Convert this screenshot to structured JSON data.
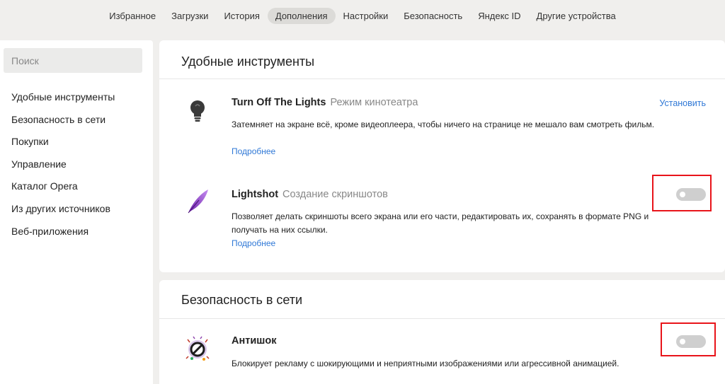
{
  "topnav": {
    "tabs": [
      {
        "label": "Избранное"
      },
      {
        "label": "Загрузки"
      },
      {
        "label": "История"
      },
      {
        "label": "Дополнения"
      },
      {
        "label": "Настройки"
      },
      {
        "label": "Безопасность"
      },
      {
        "label": "Яндекс ID"
      },
      {
        "label": "Другие устройства"
      }
    ],
    "active": "Дополнения"
  },
  "sidebar": {
    "search_placeholder": "Поиск",
    "items": [
      {
        "label": "Удобные инструменты"
      },
      {
        "label": "Безопасность в сети"
      },
      {
        "label": "Покупки"
      },
      {
        "label": "Управление"
      },
      {
        "label": "Каталог Opera"
      },
      {
        "label": "Из других источников"
      },
      {
        "label": "Веб-приложения"
      }
    ]
  },
  "sections": [
    {
      "title": "Удобные инструменты",
      "extensions": [
        {
          "name": "Turn Off The Lights",
          "subtitle": "Режим кинотеатра",
          "description": "Затемняет на экране всё, кроме видеоплеера, чтобы ничего на странице не мешало вам смотреть фильм.",
          "more_label": "Подробнее",
          "action_label": "Установить",
          "icon": "lightbulb-icon"
        },
        {
          "name": "Lightshot",
          "subtitle": "Создание скриншотов",
          "description": "Позволяет делать скриншоты всего экрана или его части, редактировать их, сохранять в формате PNG и получать на них ссылки.",
          "more_label": "Подробнее",
          "enabled": false,
          "icon": "feather-icon"
        }
      ]
    },
    {
      "title": "Безопасность в сети",
      "extensions": [
        {
          "name": "Антишок",
          "subtitle": "",
          "description": "Блокирует рекламу с шокирующими и неприятными изображениями или агрессивной анимацией.",
          "enabled": false,
          "icon": "antishock-icon"
        }
      ]
    }
  ],
  "colors": {
    "accent_link": "#2f78d6",
    "highlight_box": "#e8141a",
    "toggle_off": "#cfcfcf"
  }
}
